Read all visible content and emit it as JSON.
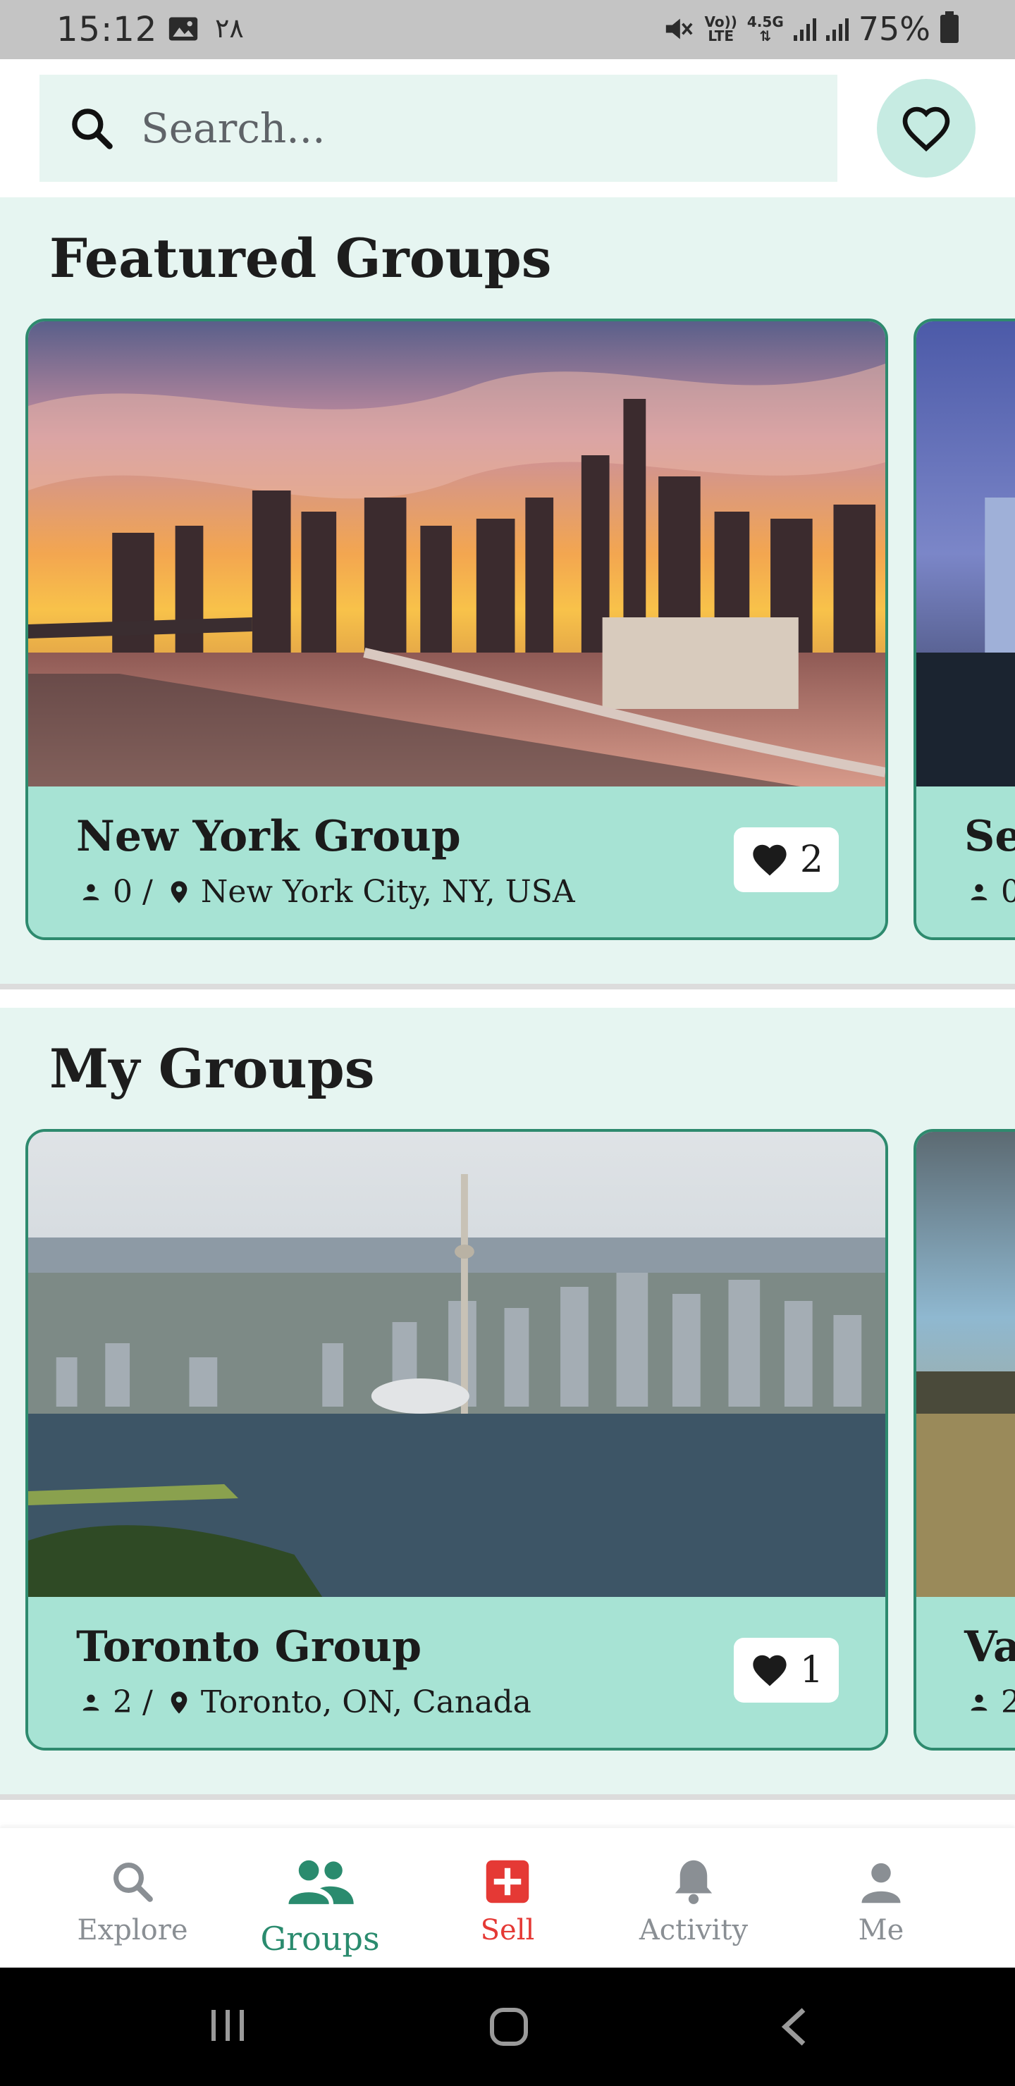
{
  "status_bar": {
    "time": "15:12",
    "indicator": "٢٨",
    "volte_top": "Vo))",
    "volte_bottom": "LTE",
    "network": "4.5G",
    "battery": "75%"
  },
  "search": {
    "placeholder": "Search..."
  },
  "colors": {
    "accent": "#2a8b6e",
    "section_bg": "#e6f5f1",
    "card_info_bg": "#a7e3d4",
    "sell": "#e53935"
  },
  "featured": {
    "title": "Featured Groups",
    "cards": [
      {
        "name": "New York Group",
        "members": "0 /",
        "location": "New York City, NY, USA",
        "likes": "2"
      },
      {
        "name": "Sea",
        "members": "0"
      }
    ]
  },
  "my_groups": {
    "title": "My Groups",
    "cards": [
      {
        "name": "Toronto Group",
        "members": "2 /",
        "location": "Toronto, ON, Canada",
        "likes": "1"
      },
      {
        "name": "Va",
        "members": "2"
      }
    ]
  },
  "bottom_nav": [
    {
      "label": "Explore",
      "icon": "search-icon"
    },
    {
      "label": "Groups",
      "icon": "groups-icon",
      "active": true
    },
    {
      "label": "Sell",
      "icon": "plus-box-icon"
    },
    {
      "label": "Activity",
      "icon": "bell-icon"
    },
    {
      "label": "Me",
      "icon": "person-icon"
    }
  ]
}
